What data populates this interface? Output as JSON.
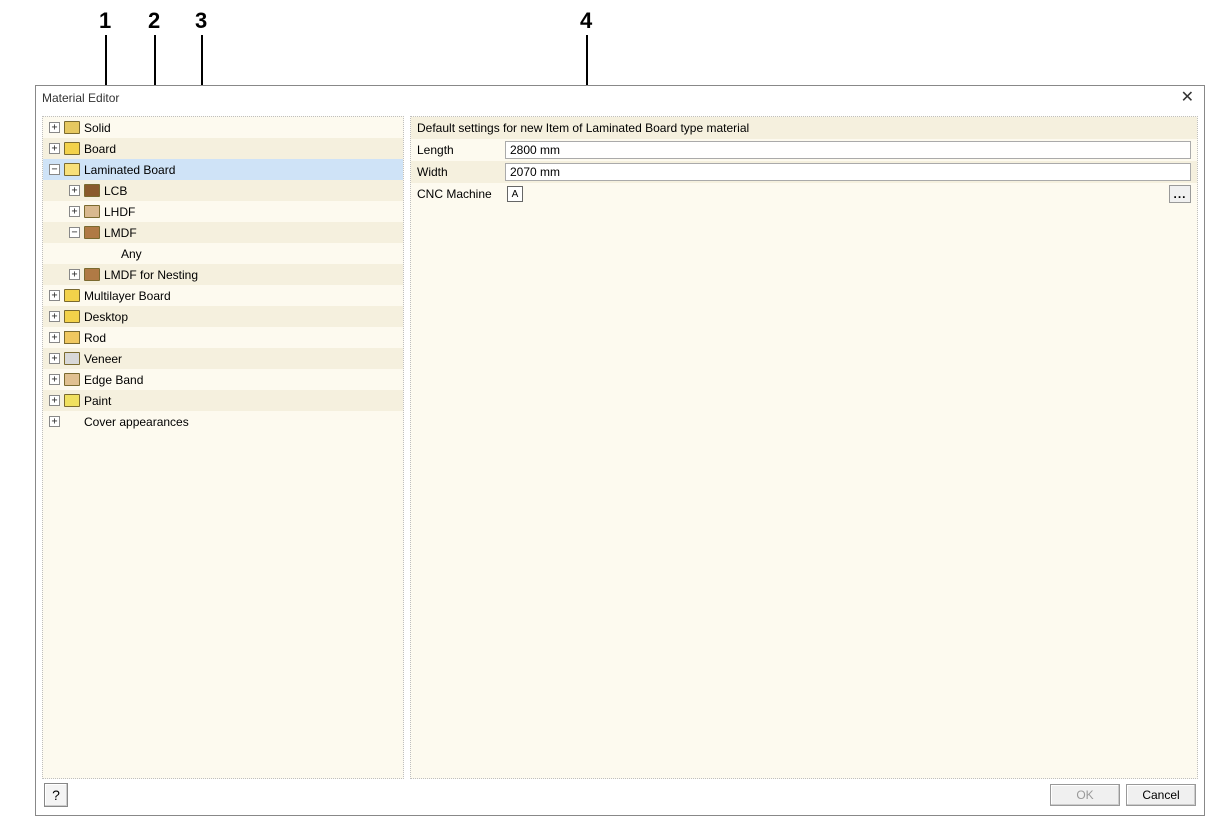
{
  "callouts": {
    "n1": "1",
    "n2": "2",
    "n3": "3",
    "n4": "4"
  },
  "dialog": {
    "title": "Material Editor",
    "close_glyph": "✕",
    "help_glyph": "?",
    "ok_label": "OK",
    "cancel_label": "Cancel"
  },
  "tree": {
    "rows": [
      {
        "label": "Solid"
      },
      {
        "label": "Board"
      },
      {
        "label": "Laminated Board"
      },
      {
        "label": "LCB"
      },
      {
        "label": "LHDF"
      },
      {
        "label": "LMDF"
      },
      {
        "label": "Any"
      },
      {
        "label": "LMDF for Nesting"
      },
      {
        "label": "Multilayer Board"
      },
      {
        "label": "Desktop"
      },
      {
        "label": "Rod"
      },
      {
        "label": "Veneer"
      },
      {
        "label": "Edge Band"
      },
      {
        "label": "Paint"
      },
      {
        "label": "Cover appearances"
      }
    ]
  },
  "details": {
    "header": "Default settings for new Item of Laminated Board type material",
    "length_label": "Length",
    "length_value": "2800 mm",
    "width_label": "Width",
    "width_value": "2070 mm",
    "cnc_label": "CNC Machine",
    "cnc_icon_glyph": "A",
    "ellipsis": "..."
  }
}
